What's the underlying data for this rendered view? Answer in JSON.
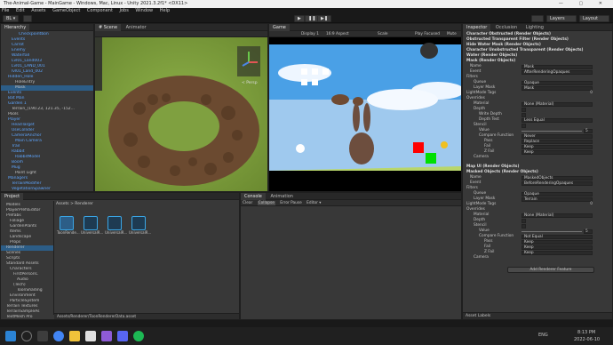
{
  "window": {
    "title": "The-Animal-Game - MainGame - Windows, Mac, Linux - Unity 2021.3.2f1* <DX11>",
    "controls": "— ▢ ✕"
  },
  "menu": [
    "File",
    "Edit",
    "Assets",
    "GameObject",
    "Component",
    "Jobs",
    "Window",
    "Help"
  ],
  "toolbar": {
    "account": "BL ▾",
    "play": "▶",
    "pause": "❚❚",
    "step": "▶❚",
    "layers": "Layers",
    "layout": "Layout"
  },
  "hierarchy": {
    "tab": "Hierarchy",
    "items": [
      {
        "label": "Checkpointbon",
        "indent": 5,
        "blue": true
      },
      {
        "label": "Events",
        "indent": 3,
        "blue": true
      },
      {
        "label": "Carrot",
        "indent": 3,
        "blue": true
      },
      {
        "label": "Enemy",
        "indent": 3,
        "blue": true
      },
      {
        "label": "Waterfall",
        "indent": 3,
        "blue": true
      },
      {
        "label": "Lvl01_Land003",
        "indent": 3,
        "blue": true
      },
      {
        "label": "Lvl01_LAND_001",
        "indent": 3,
        "blue": true
      },
      {
        "label": "lvl01_Land_002",
        "indent": 3,
        "blue": true
      },
      {
        "label": "Hidden_Hole",
        "indent": 2,
        "blue": true
      },
      {
        "label": "HoleEntry",
        "indent": 4,
        "blue": false
      },
      {
        "label": "Mask",
        "indent": 4,
        "blue": false,
        "selected": true
      },
      {
        "label": "Events",
        "indent": 2,
        "blue": true
      },
      {
        "label": "Bat Man",
        "indent": 2,
        "blue": true
      },
      {
        "label": "Garden 1",
        "indent": 2,
        "blue": true
      },
      {
        "label": "Terrain_(190.23, 121.35, -152...",
        "indent": 3,
        "blue": false
      },
      {
        "label": "Pools",
        "indent": 2,
        "blue": false
      },
      {
        "label": "Player",
        "indent": 2,
        "blue": true
      },
      {
        "label": "HeadTarget",
        "indent": 3,
        "blue": true
      },
      {
        "label": "UseCollider",
        "indent": 3,
        "blue": true
      },
      {
        "label": "CameraAnchor",
        "indent": 3,
        "blue": true
      },
      {
        "label": "Main Camera",
        "indent": 4,
        "blue": true
      },
      {
        "label": "Trail",
        "indent": 3,
        "blue": true
      },
      {
        "label": "Rabbit",
        "indent": 3,
        "blue": true
      },
      {
        "label": "RabbitModel",
        "indent": 4,
        "blue": true
      },
      {
        "label": "Boom",
        "indent": 3,
        "blue": true
      },
      {
        "label": "Mug",
        "indent": 3,
        "blue": true
      },
      {
        "label": "Point Light",
        "indent": 4,
        "blue": false
      },
      {
        "label": "Managers",
        "indent": 2,
        "blue": true
      },
      {
        "label": "TerrainModifier",
        "indent": 3,
        "blue": true
      },
      {
        "label": "VegetationSpawner",
        "indent": 3,
        "blue": true
      }
    ]
  },
  "scene": {
    "tabs": [
      "# Scene",
      "Animator"
    ],
    "persp": "< Persp"
  },
  "game": {
    "tab": "Game",
    "display": "Display 1",
    "aspect": "16:9 Aspect",
    "scale": "Scale",
    "play_focused": "Play Focused",
    "mute": "Mute"
  },
  "inspector": {
    "tabs": [
      "Inspector",
      "Occlusion",
      "Lighting"
    ],
    "features": [
      "Character Obstructed (Render Objects)",
      "Obstructed Transparent Filter (Render Objects)",
      "Hide Water Mask (Render Objects)",
      "Character Unobstructed Transparent (Render Objects)",
      "Water (Render Objects)",
      "Mask (Render Objects)"
    ],
    "mask": {
      "name_label": "Name",
      "name": "Mask",
      "event_label": "Event",
      "event": "AfterRenderingOpaques",
      "filters": "Filters",
      "queue_label": "Queue",
      "queue": "Opaque",
      "layer_label": "Layer Mask",
      "layer": "Mask",
      "lightmode": "LightMode Tags",
      "lightmode_val": "0",
      "overrides": "Overrides",
      "material_label": "Material",
      "material": "None (Material)",
      "depth_label": "Depth",
      "write_depth": "Write Depth",
      "depth_test_label": "Depth Test",
      "depth_test": "Less Equal",
      "stencil_label": "Stencil",
      "value_label": "Value",
      "value": "5",
      "compare_label": "Compare Function",
      "compare": "Never",
      "pass_label": "Pass",
      "pass": "Replace",
      "fail_label": "Fail",
      "fail": "Keep",
      "zfail_label": "Z Fail",
      "zfail": "Keep",
      "camera_label": "Camera"
    },
    "map_ui": "Map UI (Render Objects)",
    "masked": {
      "header": "Masked Objects (Render Objects)",
      "name_label": "Name",
      "name": "MaskedObjects",
      "event_label": "Event",
      "event": "BeforeRenderingOpaques",
      "filters": "Filters",
      "queue_label": "Queue",
      "queue": "Opaque",
      "layer_label": "Layer Mask",
      "layer": "Terrain",
      "lightmode": "LightMode Tags",
      "lightmode_val": "0",
      "overrides": "Overrides",
      "material_label": "Material",
      "material": "None (Material)",
      "depth_label": "Depth",
      "stencil_label": "Stencil",
      "value_label": "Value",
      "value": "5",
      "compare_label": "Compare Function",
      "compare": "Not Equal",
      "pass_label": "Pass",
      "pass": "Keep",
      "fail_label": "Fail",
      "fail": "Keep",
      "zfail_label": "Z Fail",
      "zfail": "Keep",
      "camera_label": "Camera"
    },
    "add_feature": "Add Renderer Feature",
    "asset_labels": "Asset Labels"
  },
  "project": {
    "tabs": [
      "Project"
    ],
    "breadcrumb": "Assets > Renderer",
    "tree": [
      "Models",
      "PlayerPrefsEditor",
      "Prefabs",
      "Foliage",
      "GardenPlants",
      "Items",
      "Landscape",
      "Props",
      "Renderer",
      "Scenes",
      "Scripts",
      "Standard Assets",
      "Characters",
      "FirstPersonC",
      "Audio",
      "(Tech)",
      "ToonShading",
      "Environment",
      "ParticleSystem",
      "Terrain Textures",
      "TerrainSampleAs",
      "TextMesh Pro",
      "VegetationSpawner"
    ],
    "assets": [
      "ToonRende...",
      "UniversalR...",
      "UniversalR...",
      "UniversalR..."
    ],
    "path": "Assets/Renderer/ToonRendererData.asset"
  },
  "console": {
    "tabs": [
      "Console",
      "Animation"
    ],
    "buttons": [
      "Clear",
      "Collapse",
      "Error Pause",
      "Editor ▾"
    ]
  },
  "taskbar": {
    "lang": "ENG",
    "time": "8:13 PM",
    "date": "2022-06-10"
  }
}
